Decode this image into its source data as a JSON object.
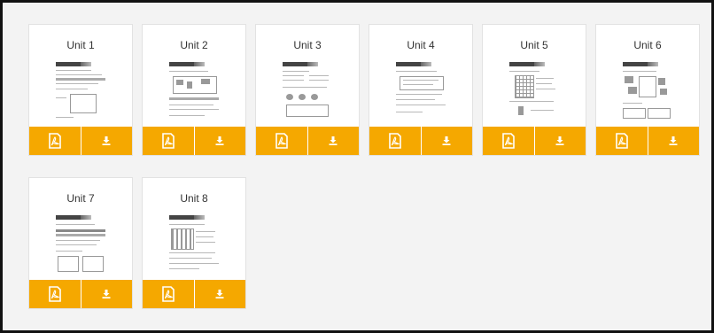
{
  "colors": {
    "accent": "#f5a800",
    "background": "#f3f3f3",
    "card": "#ffffff",
    "icon": "#ffffff"
  },
  "icons": {
    "open": "pdf-icon",
    "download": "download-icon"
  },
  "units": [
    {
      "title": "Unit 1"
    },
    {
      "title": "Unit 2"
    },
    {
      "title": "Unit 3"
    },
    {
      "title": "Unit 4"
    },
    {
      "title": "Unit 5"
    },
    {
      "title": "Unit 6"
    },
    {
      "title": "Unit 7"
    },
    {
      "title": "Unit 8"
    }
  ]
}
